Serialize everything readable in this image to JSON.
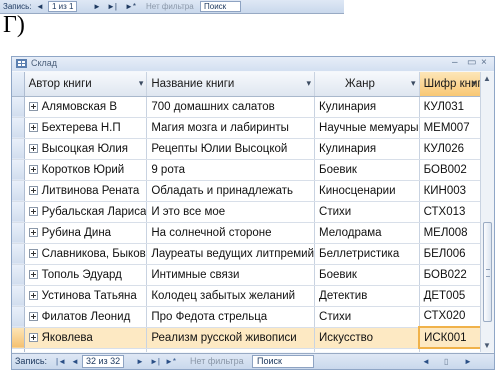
{
  "top_nav": {
    "record_label": "Запись:",
    "first": "◄",
    "position": "1 из 1",
    "next": "►",
    "last": "►|",
    "new_record": "►*",
    "filter": "Нет фильтра",
    "search": "Поиск"
  },
  "caption": "Г)",
  "window": {
    "title": "Склад",
    "minimize": "–",
    "restore": "▭",
    "close": "×"
  },
  "table": {
    "columns": [
      "Автор книги",
      "Название книги",
      "Жанр",
      "Шифр книги"
    ],
    "rows": [
      {
        "author": "Алямовская В",
        "title": "700 домашних салатов",
        "genre": "Кулинария",
        "code": "КУЛ031"
      },
      {
        "author": "Бехтерева Н.П",
        "title": "Магия мозга и лабиринты",
        "genre": "Научные мемуары",
        "code": "МЕМ007"
      },
      {
        "author": "Высоцкая Юлия",
        "title": "Рецепты Юлии Высоцкой",
        "genre": "Кулинария",
        "code": "КУЛ026"
      },
      {
        "author": "Коротков Юрий",
        "title": "9 рота",
        "genre": "Боевик",
        "code": "БОВ002"
      },
      {
        "author": "Литвинова Рената",
        "title": "Обладать и принадлежать",
        "genre": "Киносценарии",
        "code": "КИН003"
      },
      {
        "author": "Рубальская Лариса",
        "title": "И это все мое",
        "genre": "Стихи",
        "code": "СТХ013"
      },
      {
        "author": "Рубина Дина",
        "title": "На солнечной стороне",
        "genre": "Мелодрама",
        "code": "МЕЛ008"
      },
      {
        "author": "Славникова, Быков",
        "title": "Лауреаты ведущих литпремий",
        "genre": "Беллетристика",
        "code": "БЕЛ006"
      },
      {
        "author": "Тополь Эдуард",
        "title": "Интимные связи",
        "genre": "Боевик",
        "code": "БОВ022"
      },
      {
        "author": "Устинова Татьяна",
        "title": "Колодец забытых желаний",
        "genre": "Детектив",
        "code": "ДЕТ005"
      },
      {
        "author": "Филатов Леонид",
        "title": "Про Федота стрельца",
        "genre": "Стихи",
        "code": "СТХ020"
      },
      {
        "author": "Яковлева",
        "title": "Реализм русской живописи",
        "genre": "Искусство",
        "code": "ИСК001"
      }
    ],
    "new_row_marker": "✱"
  },
  "navbar": {
    "record_label": "Запись:",
    "first": "|◄",
    "prev": "◄",
    "position": "32 из 32",
    "next": "►",
    "last": "►|",
    "new_record": "►*",
    "filter": "Нет фильтра",
    "search": "Поиск"
  },
  "colors": {
    "active_header": "#f8c774",
    "current_row": "#fde9c3",
    "chrome_blue": "#c9d8ec"
  }
}
